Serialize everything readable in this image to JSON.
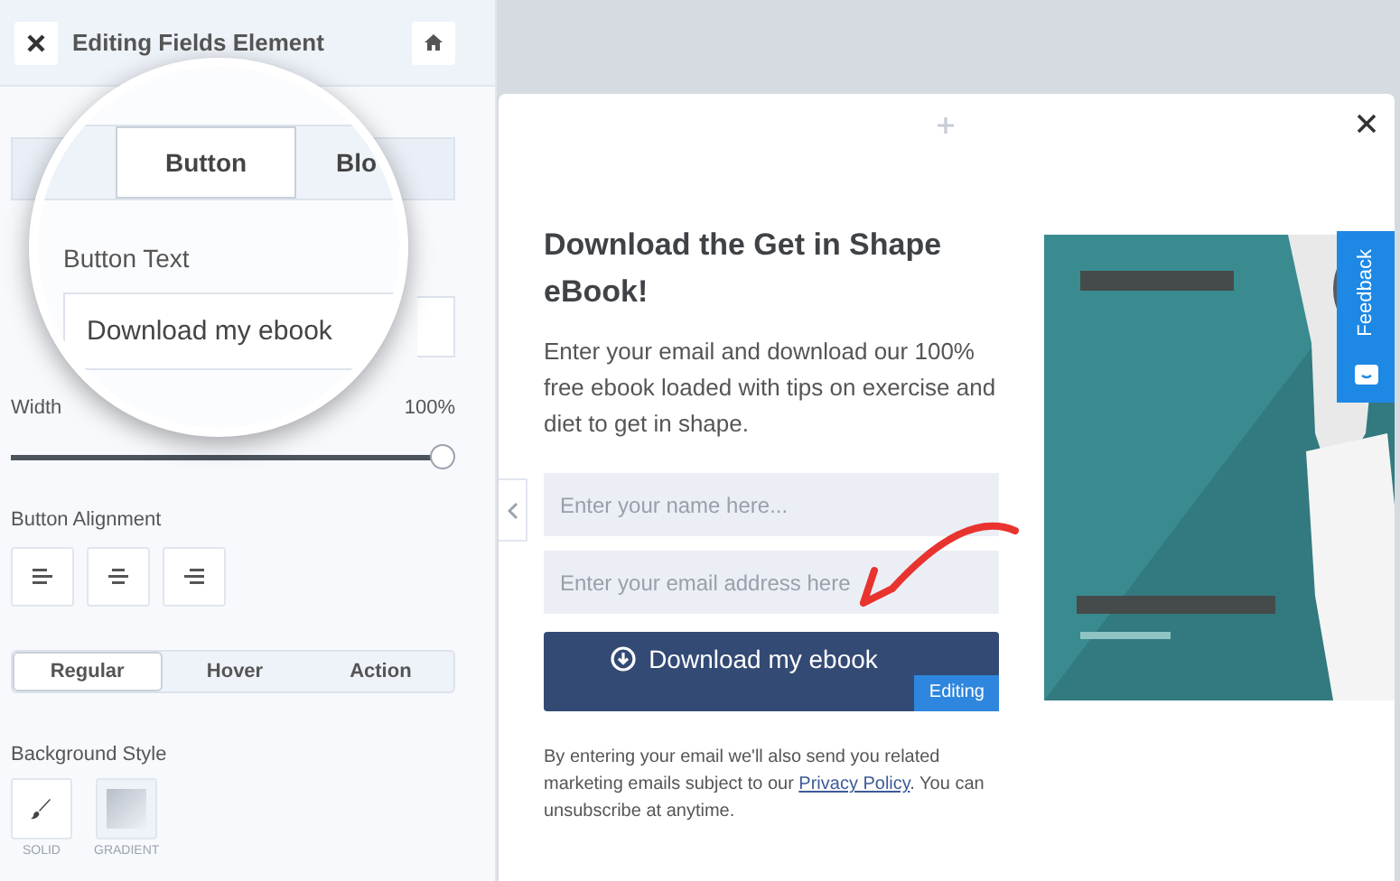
{
  "panel": {
    "title": "Editing Fields Element"
  },
  "magnifier": {
    "tabs": [
      {
        "label": "Button",
        "selected": true
      },
      {
        "label": "Blo",
        "selected": false
      }
    ],
    "field_label": "Button Text",
    "field_value": "Download my ebook"
  },
  "width": {
    "label": "Width",
    "reading": "100%",
    "level": 1
  },
  "alignment": {
    "label": "Button Alignment",
    "options": [
      {
        "kind": "left"
      },
      {
        "kind": "center"
      },
      {
        "kind": "right"
      }
    ]
  },
  "state_tabs": [
    {
      "label": "Regular",
      "selected": true
    },
    {
      "label": "Hover",
      "selected": false
    },
    {
      "label": "Action",
      "selected": false
    }
  ],
  "background_style": {
    "label": "Background Style",
    "options": [
      {
        "kind": "solid",
        "label": "SOLID",
        "selected": true
      },
      {
        "kind": "gradient",
        "label": "GRADIENT",
        "selected": false
      }
    ]
  },
  "popup": {
    "title": "Download the Get in Shape eBook!",
    "body": "Enter your email and download our 100% free ebook loaded with tips on exercise and diet to get in shape.",
    "fields": [
      {
        "placeholder": "Enter your name here..."
      },
      {
        "placeholder": "Enter your email address here"
      }
    ],
    "button": "Download my ebook",
    "badge": "Editing",
    "disclaimer_before": "By entering your email we'll also send you related marketing emails subject to our",
    "link": "Privacy Policy",
    "disclaimer_after": ". You can unsubscribe at anytime."
  },
  "feedback": "Feedback"
}
